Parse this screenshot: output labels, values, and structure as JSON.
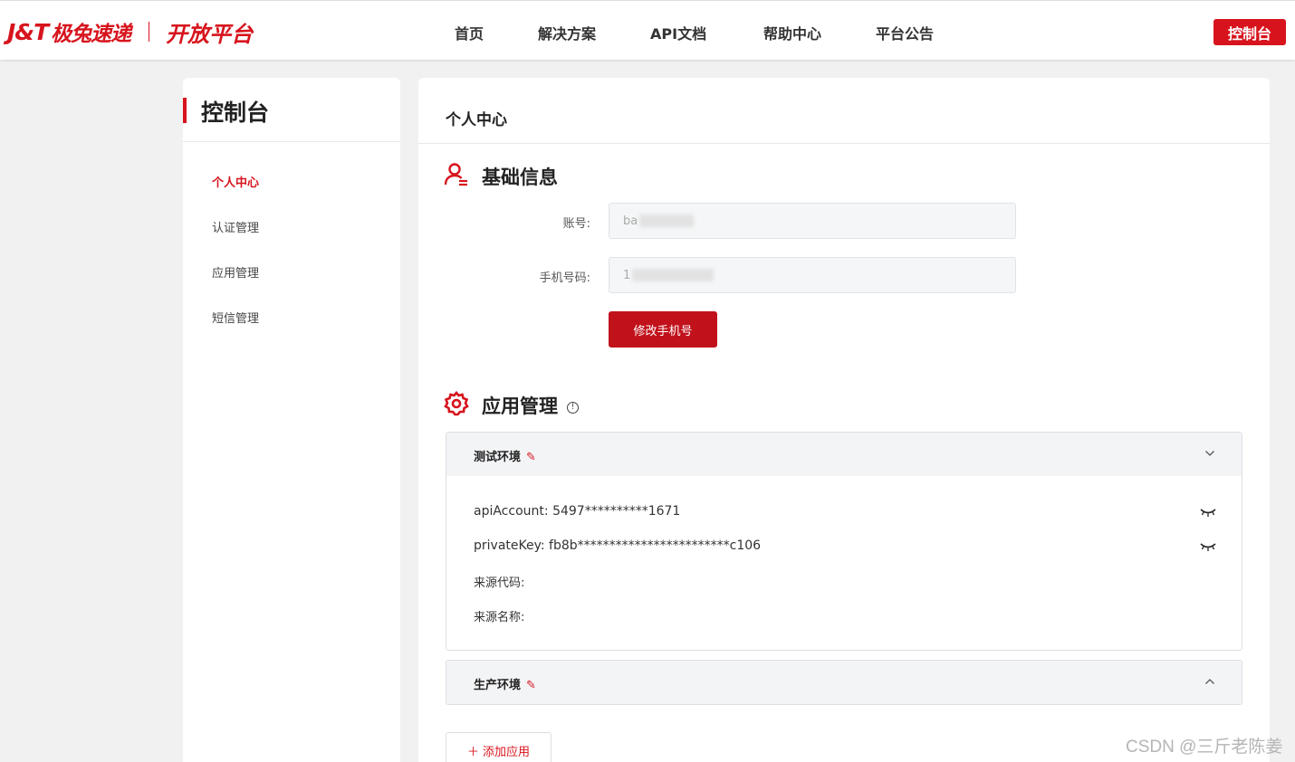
{
  "header": {
    "logo_jt": "J&T",
    "logo_cn": "极兔速递",
    "logo_open": "开放平台",
    "nav": [
      "首页",
      "解决方案",
      "API文档",
      "帮助中心",
      "平台公告"
    ],
    "console_button": "控制台",
    "accent_color": "#d7141d"
  },
  "sidebar": {
    "title": "控制台",
    "items": [
      {
        "label": "个人中心",
        "active": true
      },
      {
        "label": "认证管理",
        "active": false
      },
      {
        "label": "应用管理",
        "active": false
      },
      {
        "label": "短信管理",
        "active": false
      }
    ]
  },
  "main": {
    "title": "个人中心",
    "basic_info": {
      "title": "基础信息",
      "icon": "user-icon",
      "account_label": "账号:",
      "account_value": "ba",
      "phone_label": "手机号码:",
      "phone_value": "1",
      "change_phone_button": "修改手机号"
    },
    "app_management": {
      "title": "应用管理",
      "icon": "gear-icon",
      "info_icon": "info-icon",
      "test_env": {
        "title": "测试环境",
        "api_account_label": "apiAccount:",
        "api_account_value": "5497**********1671",
        "private_key_label": "privateKey:",
        "private_key_value": "fb8b************************c106",
        "source_code_label": "来源代码:",
        "source_name_label": "来源名称:"
      },
      "prod_env": {
        "title": "生产环境"
      },
      "add_app_button": "添加应用",
      "add_icon": "＋"
    }
  },
  "watermark": "CSDN @三斤老陈姜"
}
